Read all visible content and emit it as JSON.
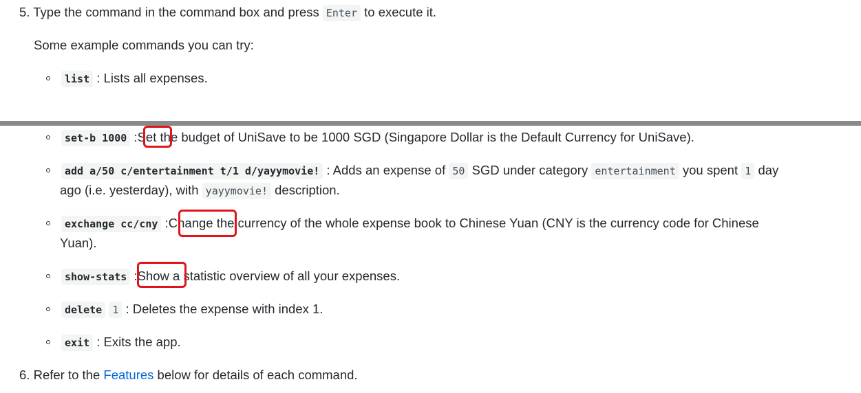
{
  "step5": {
    "number": "5.",
    "before": "Type the command in the command box and press",
    "key": "Enter",
    "after": "to execute it."
  },
  "intro": "Some example commands you can try:",
  "commands": [
    {
      "code": "list",
      "desc": ": Lists all expenses."
    },
    {
      "code": "set-b 1000",
      "sep": ":",
      "verb": "Set",
      "rest": "the budget of UniSave to be 1000 SGD (Singapore Dollar is the Default Currency for UniSave)."
    },
    {
      "code": "add a/50 c/entertainment t/1 d/yayymovie!",
      "t1": ": Adds an expense of",
      "c1": "50",
      "t2": "SGD under category",
      "c2": "entertainment",
      "t3": "you spent",
      "c3": "1",
      "t4": "day",
      "l2a": "ago (i.e. yesterday), with",
      "c4": "yayymovie!",
      "l2b": "description."
    },
    {
      "code": "exchange cc/cny",
      "sep": ":",
      "verb": "Change",
      "rest": "the currency of the whole expense book to Chinese Yuan (CNY is the currency code for Chinese",
      "line2": "Yuan)."
    },
    {
      "code": "show-stats",
      "sep": ":",
      "verb": "Show",
      "rest": "a statistic overview of all your expenses."
    },
    {
      "code": "delete",
      "code2": "1",
      "desc": ": Deletes the expense with index 1."
    },
    {
      "code": "exit",
      "desc": ": Exits the app."
    }
  ],
  "step6": {
    "number": "6.",
    "before": "Refer to the",
    "link": "Features",
    "after": "below for details of each command."
  },
  "colors": {
    "highlight": "#e0141b",
    "link": "#0366d6",
    "divider": "#8a8a8a"
  }
}
